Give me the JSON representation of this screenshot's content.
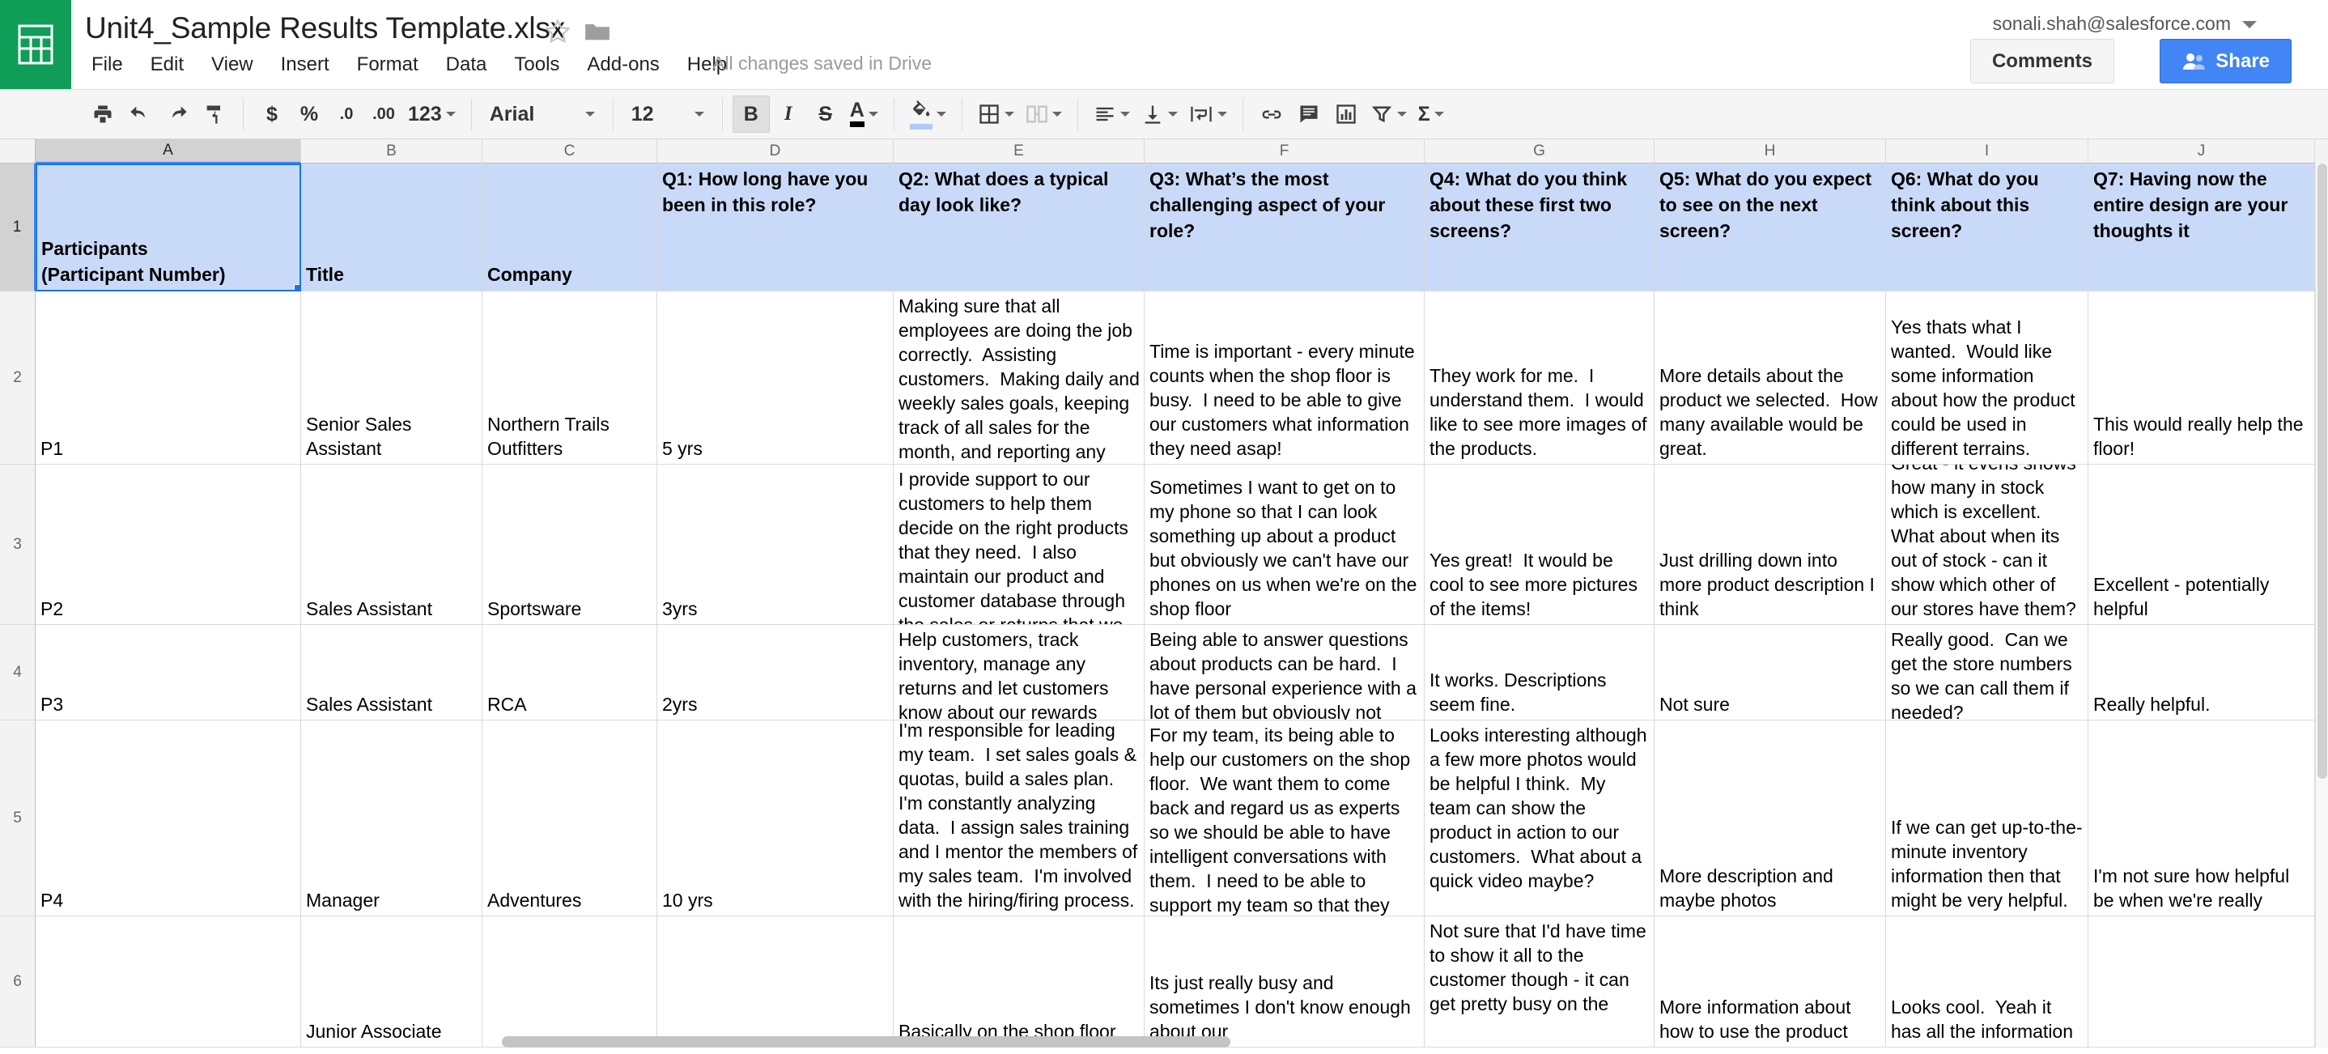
{
  "app": {
    "logo_icon": "sheets-grid-icon",
    "brand_color": "#0f9d58",
    "accent_color": "#4285f4",
    "header_fill_color": "#c9daf8"
  },
  "header": {
    "doc_title": "Unit4_Sample Results Template.xlsx",
    "star_icon": "star-outline-icon",
    "folder_icon": "folder-icon",
    "save_status": "All changes saved in Drive",
    "account_email": "sonali.shah@salesforce.com",
    "account_caret_icon": "chevron-down-icon",
    "comments_label": "Comments",
    "share_label": "Share",
    "share_icon": "person-add-icon",
    "menus": [
      "File",
      "Edit",
      "View",
      "Insert",
      "Format",
      "Data",
      "Tools",
      "Add-ons",
      "Help"
    ]
  },
  "toolbar": {
    "print_icon": "print-icon",
    "undo_icon": "undo-icon",
    "redo_icon": "redo-icon",
    "paint_format_icon": "paint-roller-icon",
    "currency_label": "$",
    "percent_label": "%",
    "decrease_decimal_label": ".0",
    "increase_decimal_label": ".00",
    "number_format_label": "123",
    "font_family": "Arial",
    "font_size": "12",
    "bold_label": "B",
    "bold_active": true,
    "italic_label": "I",
    "strikethrough_label": "S",
    "text_color_label": "A",
    "text_color": "#000000",
    "fill_color_icon": "paint-bucket-icon",
    "fill_color": "#aecbfa",
    "borders_icon": "borders-icon",
    "merge_cells_icon": "merge-cells-icon",
    "halign_icon": "align-left-icon",
    "valign_icon": "align-bottom-icon",
    "wrap_icon": "text-wrap-icon",
    "link_icon": "link-icon",
    "comment_icon": "comment-icon",
    "chart_icon": "insert-chart-icon",
    "filter_icon": "filter-icon",
    "functions_label": "Σ"
  },
  "sheet": {
    "columns": [
      "A",
      "B",
      "C",
      "D",
      "E",
      "F",
      "G",
      "H",
      "I",
      "J"
    ],
    "selected_column": "A",
    "selected_row": "1",
    "active_cell": "A1",
    "row_numbers": [
      "1",
      "2",
      "3",
      "4",
      "5",
      "6"
    ],
    "headers": [
      "Participants\n(Participant Number)",
      "Title",
      "Company",
      "Q1: How long have you been in this role?",
      "Q2: What does a typical day look like?",
      "Q3: What’s the most challenging aspect of your role?",
      "Q4: What do you think about these first two screens?",
      "Q5: What do you expect to see on the next screen?",
      "Q6: What do you think about this screen?",
      "Q7: Having now the entire design are your thoughts it"
    ],
    "rows": [
      [
        "P1",
        "Senior Sales Assistant",
        "Northern Trails Outfitters",
        "5 yrs",
        "Making sure that all employees are doing the job correctly.  Assisting customers.  Making daily and weekly sales goals, keeping track of all sales for the month, and reporting any problems to my manager.",
        "Time is important - every minute counts when the shop floor is busy.  I need to be able to give our customers what information they need asap!",
        "They work for me.  I understand them.  I would like to see more images of the products.",
        "More details about the product we selected.  How many available would be great.",
        "Yes thats what I wanted.  Would like some information about how the product could be used in different terrains.",
        "This would really help the floor!"
      ],
      [
        "P2",
        "Sales Assistant",
        "Sportsware",
        "3yrs",
        "I provide support to our customers to help them decide on the right products that they need.  I also maintain our product and customer database through the sales or returns that we receive",
        "Sometimes I want to get on to my phone so that I can look something up about a product but obviously we can't have our phones on us when we're on the shop floor",
        "Yes great!  It would be cool to see more pictures of the items!",
        "Just drilling down into more product description I think",
        "Great - it evens shows how many in stock which is excellent. What about when its out of stock - can it show which other of our stores have them?",
        "Excellent - potentially helpful"
      ],
      [
        "P3",
        "Sales Assistant",
        "RCA",
        "2yrs",
        "Help customers, track inventory, manage any returns and let customers know about our rewards program",
        "Being able to answer questions about products can be hard.  I have personal experience with a lot of them but obviously not all...",
        "It works. Descriptions seem fine.",
        "Not sure",
        "Really good.  Can we get the store numbers so we can call them if needed?",
        "Really helpful."
      ],
      [
        "P4",
        "Manager",
        "Adventures",
        "10 yrs",
        "I'm responsible for leading my team.  I set sales goals & quotas, build a sales plan.  I'm constantly analyzing data.  I assign sales training and I mentor the members of my sales team.  I'm involved with the hiring/firing process.",
        "For my team, its being able to help our customers on the shop floor.  We want them to come back and regard us as experts so we should be able to have intelligent conversations with them.  I need to be able to support my team so that they can do this...",
        "Looks interesting although a few more photos would be helpful I think.  My team can show the product in action to our customers.  What about a quick video maybe?",
        "More description and maybe photos",
        "If we can get up-to-the-minute inventory information then that might be very helpful.",
        "I'm not sure how helpful be when we're really"
      ],
      [
        "",
        "Junior Associate",
        "",
        "",
        "Basically on the shop floor",
        "Its just really busy and sometimes I don't know enough about our",
        "Not sure that I'd have time to show it all to the customer though - it can get pretty busy on the",
        "More information about how to use the product",
        "Looks cool.  Yeah it has all the information",
        ""
      ]
    ]
  }
}
